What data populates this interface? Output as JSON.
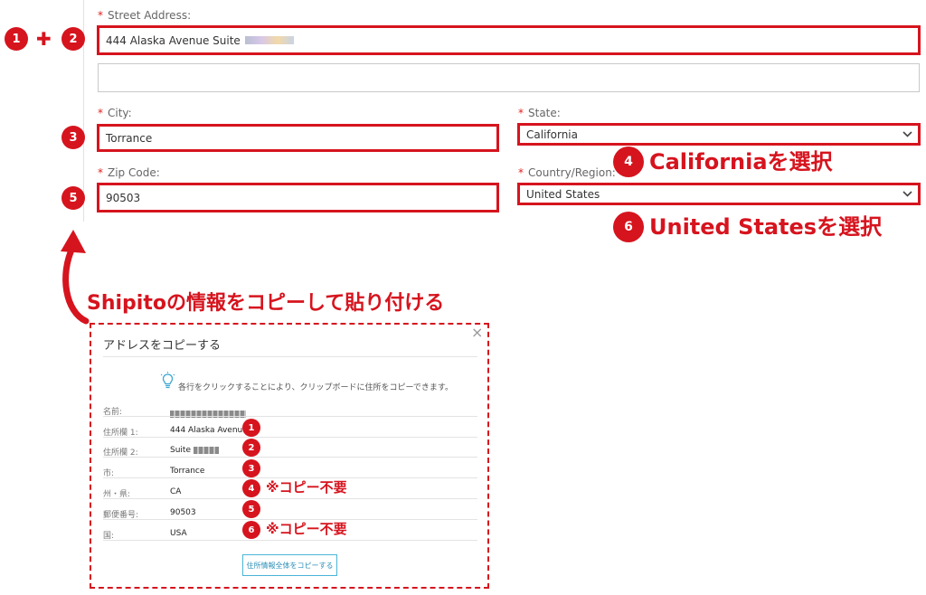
{
  "form": {
    "street_label": "Street Address:",
    "street_value": "444 Alaska Avenue  Suite",
    "city_label": "City:",
    "city_value": "Torrance",
    "state_label": "State:",
    "state_value": "California",
    "zip_label": "Zip Code:",
    "zip_value": "90503",
    "country_label": "Country/Region:",
    "country_value": "United States"
  },
  "annotations": {
    "plus": "✚",
    "state_note": "Californiaを選択",
    "country_note": "United Statesを選択",
    "copy_instruction": "Shipitoの情報をコピーして貼り付ける",
    "no_copy": "※コピー不要"
  },
  "badges": [
    "1",
    "2",
    "3",
    "4",
    "5",
    "6"
  ],
  "dialog": {
    "title": "アドレスをコピーする",
    "close": "×",
    "hint": "各行をクリックすることにより、クリップボードに住所をコピーできます。",
    "rows": [
      {
        "label": "名前:",
        "value": ""
      },
      {
        "label": "住所欄 1:",
        "value": "444 Alaska Avenue"
      },
      {
        "label": "住所欄 2:",
        "value": "Suite"
      },
      {
        "label": "市:",
        "value": "Torrance"
      },
      {
        "label": "州・県:",
        "value": "CA"
      },
      {
        "label": "郵便番号:",
        "value": "90503"
      },
      {
        "label": "国:",
        "value": "USA"
      }
    ],
    "copy_all_button": "住所情報全体をコピーする"
  },
  "colors": {
    "accent": "#d6141e",
    "button_border": "#4ab4d8"
  },
  "icons": {
    "chevron": "chevron-down-icon",
    "lightbulb": "lightbulb-icon",
    "arrow": "curved-arrow-icon"
  }
}
